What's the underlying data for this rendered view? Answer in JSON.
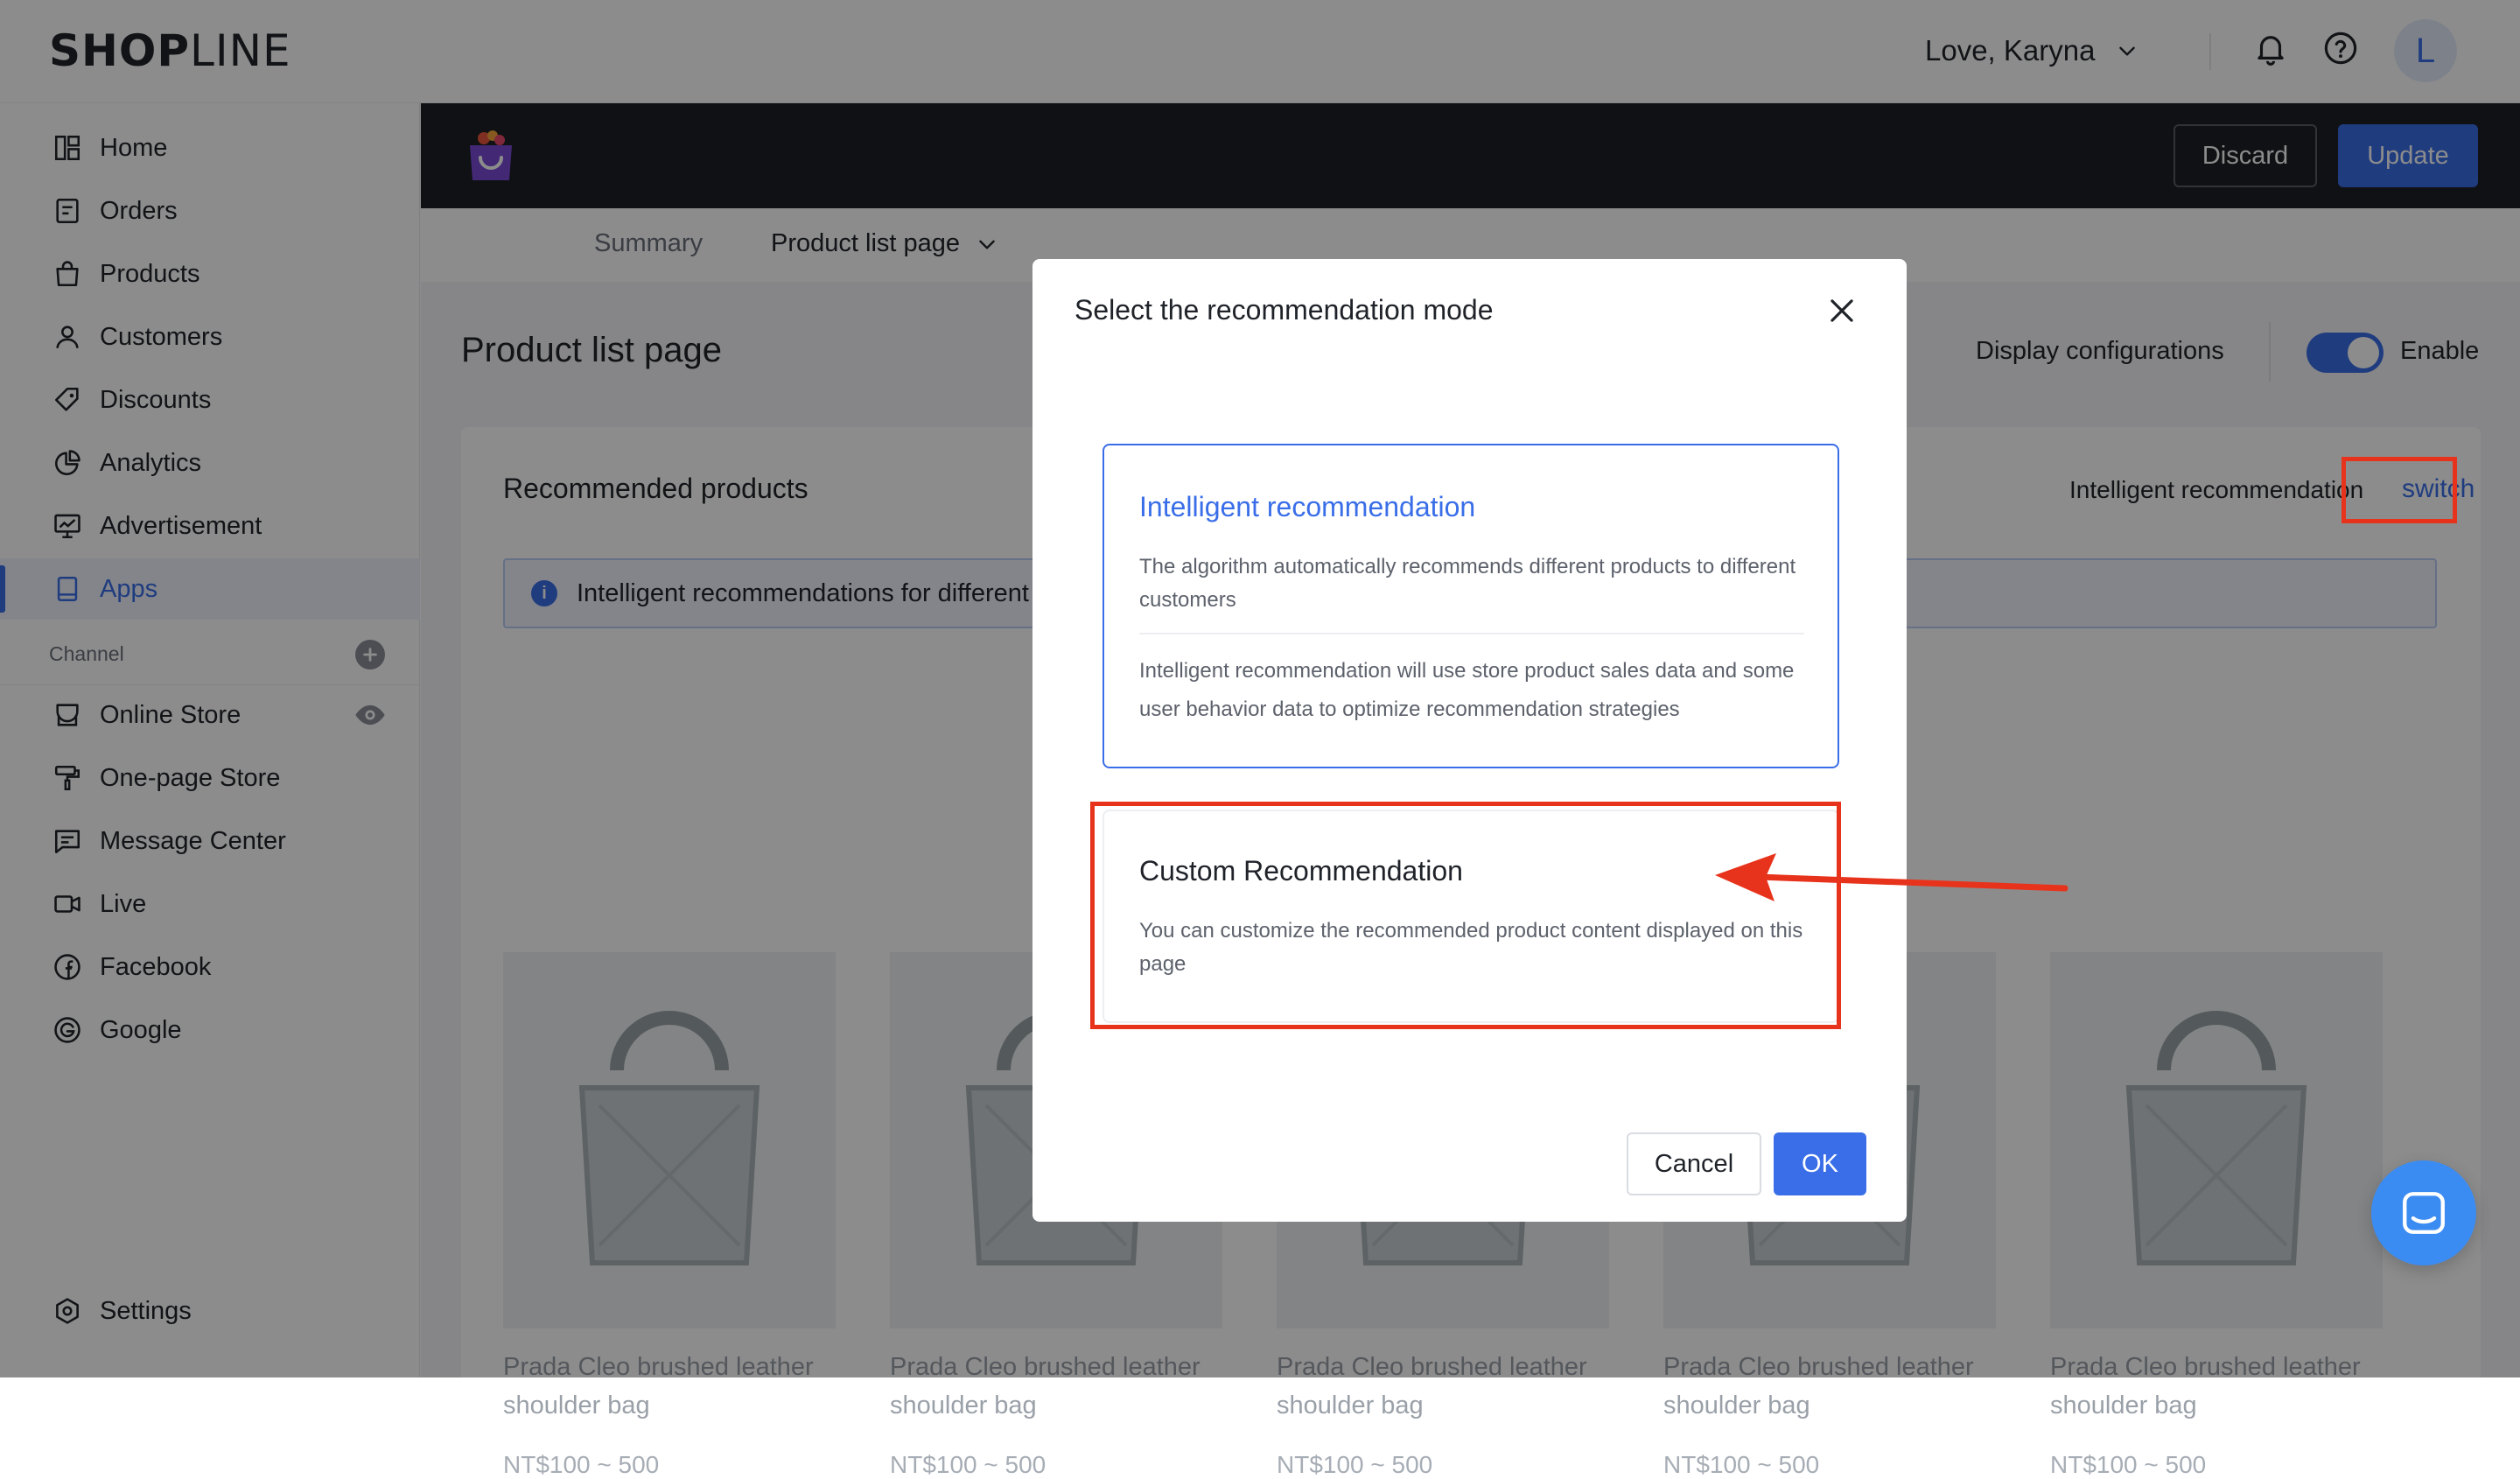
{
  "topbar": {
    "logo_bold": "SHOP",
    "logo_light": "LINE",
    "user_name": "Love, Karyna",
    "avatar_initial": "L"
  },
  "sidebar": {
    "items": [
      {
        "label": "Home",
        "icon": "home-icon"
      },
      {
        "label": "Orders",
        "icon": "orders-icon"
      },
      {
        "label": "Products",
        "icon": "bag-icon"
      },
      {
        "label": "Customers",
        "icon": "user-icon"
      },
      {
        "label": "Discounts",
        "icon": "tag-icon"
      },
      {
        "label": "Analytics",
        "icon": "pie-chart-icon"
      },
      {
        "label": "Advertisement",
        "icon": "monitor-chart-icon"
      },
      {
        "label": "Apps",
        "icon": "tablet-icon",
        "active": true
      }
    ],
    "channel_label": "Channel",
    "channel_items": [
      {
        "label": "Online Store",
        "icon": "store-icon"
      },
      {
        "label": "One-page Store",
        "icon": "paint-roller-icon"
      },
      {
        "label": "Message Center",
        "icon": "message-icon"
      },
      {
        "label": "Live",
        "icon": "video-icon"
      },
      {
        "label": "Facebook",
        "icon": "facebook-icon"
      },
      {
        "label": "Google",
        "icon": "google-icon"
      }
    ],
    "settings_label": "Settings"
  },
  "app_header": {
    "discard_label": "Discard",
    "update_label": "Update"
  },
  "tabs": {
    "summary": "Summary",
    "product_list": "Product list page"
  },
  "page": {
    "title": "Product list page",
    "display_config": "Display configurations",
    "enable_label": "Enable",
    "enabled": true
  },
  "panel": {
    "title": "Recommended products",
    "mode_label": "Intelligent recommendation",
    "switch_label": "switch",
    "info_text": "Intelligent recommendations for different",
    "products": [
      {
        "name": "Prada Cleo brushed leather shoulder bag",
        "price": "NT$100 ~ 500"
      },
      {
        "name": "Prada Cleo brushed leather shoulder bag",
        "price": "NT$100 ~ 500"
      },
      {
        "name": "Prada Cleo brushed leather shoulder bag",
        "price": "NT$100 ~ 500"
      },
      {
        "name": "Prada Cleo brushed leather shoulder bag",
        "price": "NT$100 ~ 500"
      },
      {
        "name": "Prada Cleo brushed leather shoulder bag",
        "price": "NT$100 ~ 500"
      }
    ]
  },
  "modal": {
    "title": "Select the recommendation mode",
    "intelligent": {
      "title": "Intelligent recommendation",
      "description": "The algorithm automatically recommends different products to different customers",
      "note": "Intelligent recommendation will use store product sales data and some user behavior data to optimize recommendation strategies"
    },
    "custom": {
      "title": "Custom Recommendation",
      "description": "You can customize the recommended product content displayed on this page"
    },
    "cancel_label": "Cancel",
    "ok_label": "OK"
  },
  "colors": {
    "accent": "#3a6ee8",
    "annotation": "#e8331c",
    "header_dark": "#1c1f26",
    "chat": "#3b8cf2"
  }
}
